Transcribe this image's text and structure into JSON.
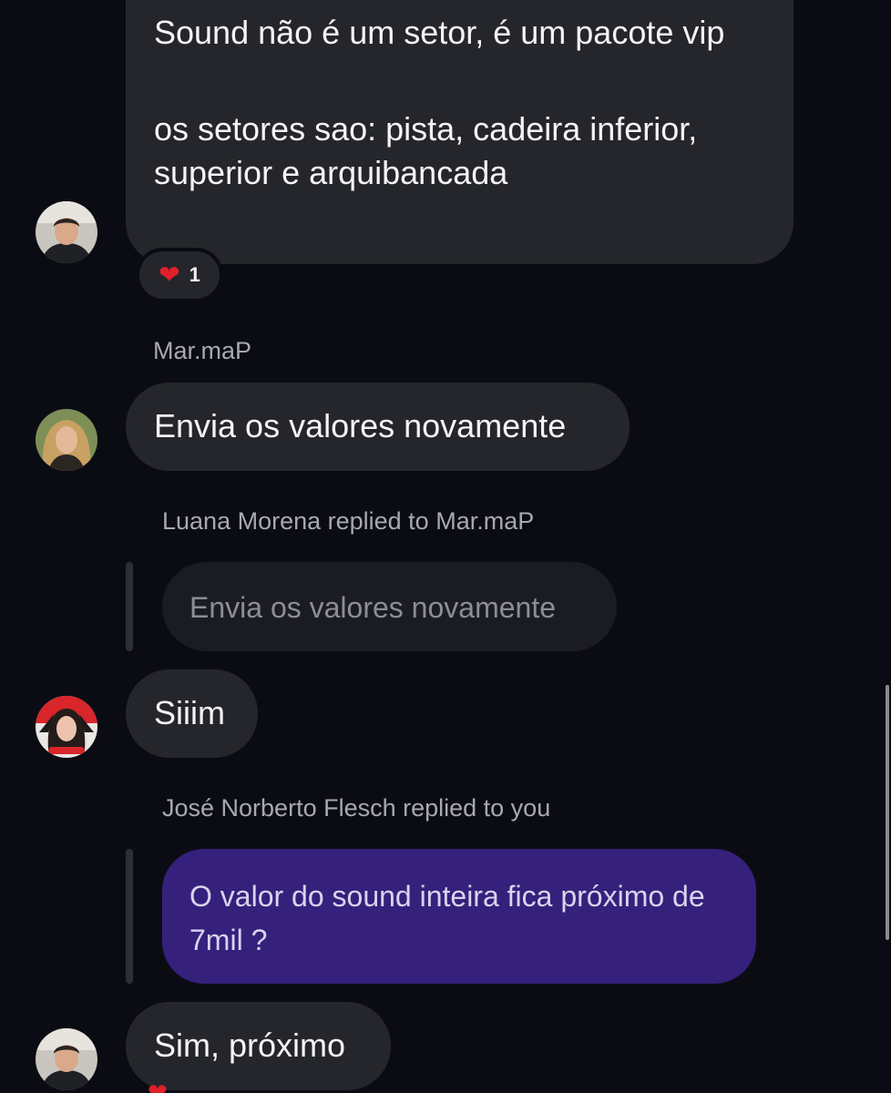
{
  "messages": [
    {
      "id": "m1",
      "paragraphs": [
        "Sound não é um setor, é um pacote vip",
        "os setores sao: pista, cadeira inferior, superior e arquibancada"
      ],
      "reaction": {
        "emoji": "❤️",
        "count": "1"
      }
    },
    {
      "id": "m2",
      "sender": "Mar.maP",
      "text": "Envia os valores novamente"
    },
    {
      "id": "m3",
      "reply_caption": "Luana Morena replied to Mar.maP",
      "quoted_text": "Envia os valores novamente",
      "text": "Siiim"
    },
    {
      "id": "m4",
      "reply_caption": "José Norberto Flesch replied to you",
      "quoted_text": "O valor do sound inteira fica próximo de 7mil ?",
      "text": "Sim, próximo",
      "reaction": {
        "emoji": "❤️"
      }
    }
  ],
  "colors": {
    "background": "#0b0c13",
    "incoming_bubble": "#25262b",
    "quoted_bubble": "#1b1c22",
    "own_quoted_bubble": "#35207c",
    "heart": "#e0202a"
  },
  "icons": {
    "reaction": "red-heart-icon"
  }
}
